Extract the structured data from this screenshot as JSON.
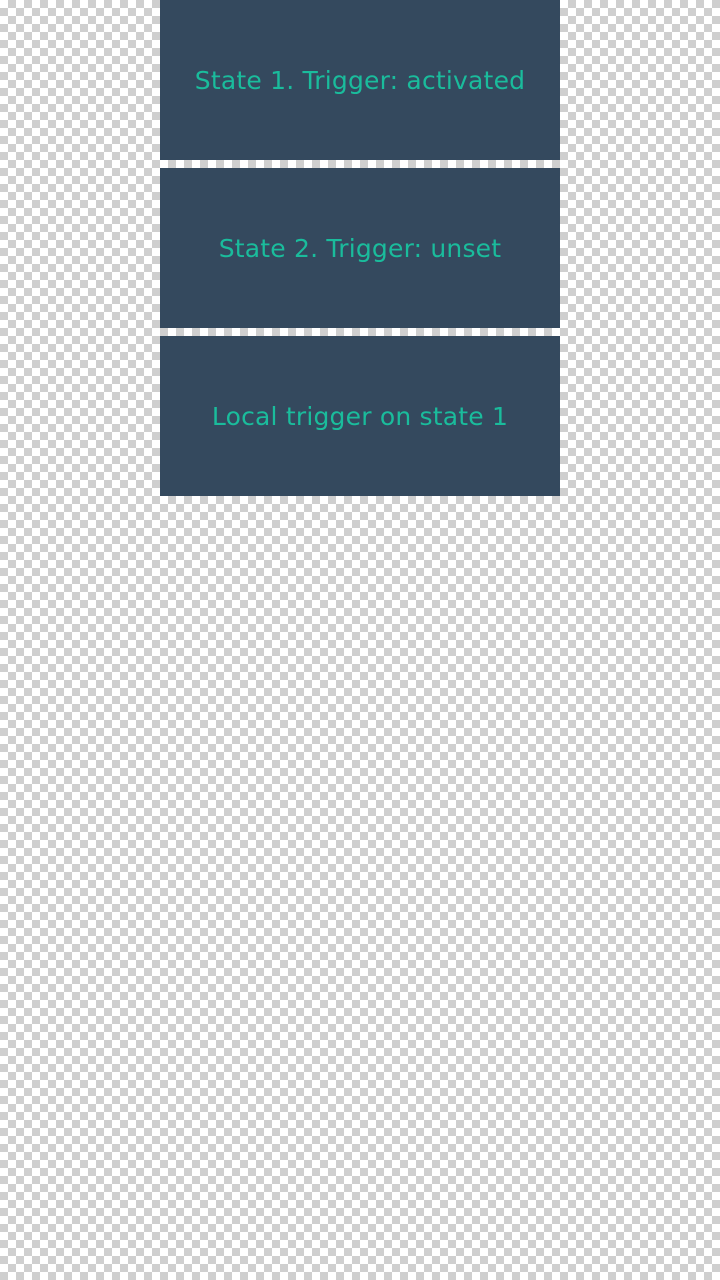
{
  "cards": [
    {
      "label": "State 1. Trigger: activated"
    },
    {
      "label": "State 2. Trigger: unset"
    },
    {
      "label": "Local trigger on state 1"
    }
  ],
  "colors": {
    "card_background": "#34495e",
    "text": "#1abc9c"
  }
}
